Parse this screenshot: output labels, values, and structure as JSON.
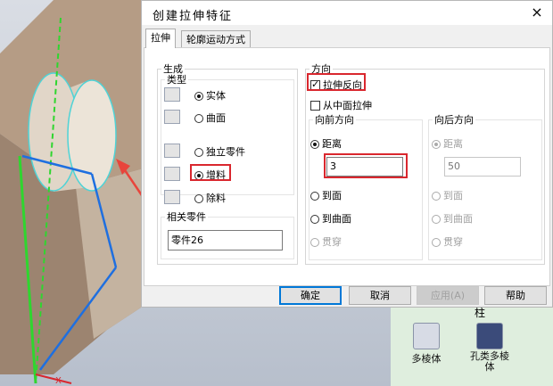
{
  "dialog": {
    "title": "创建拉伸特征",
    "close_label": "×"
  },
  "tabs": [
    {
      "label": "拉伸"
    },
    {
      "label": "轮廓运动方式"
    }
  ],
  "generate": {
    "legend": "生成",
    "type_legend": "类型",
    "solid": "实体",
    "surface": "曲面",
    "independent": "独立零件",
    "add": "增料",
    "remove": "除料",
    "related_legend": "相关零件",
    "related_value": "零件26"
  },
  "direction": {
    "legend": "方向",
    "reverse": "拉伸反向",
    "from_middle": "从中面拉伸",
    "forward_legend": "向前方向",
    "backward_legend": "向后方向",
    "distance": "距离",
    "to_face": "到面",
    "to_curved_face": "到曲面",
    "through": "贯穿",
    "forward_value": "3",
    "backward_value": "50"
  },
  "buttons": {
    "ok": "确定",
    "cancel": "取消",
    "apply": "应用(A)",
    "help": "帮助"
  },
  "palette": {
    "header": "柱",
    "prism": "多棱体",
    "hole_line1": "孔类多棱",
    "hole_line2": "体"
  },
  "viewport": {
    "axis_x": "X"
  },
  "colors": {
    "highlight": "#d9272e",
    "cylinder_outline": "#4fd3d6",
    "axis_green": "#2fd62f",
    "axis_blue": "#1e6fe0"
  }
}
